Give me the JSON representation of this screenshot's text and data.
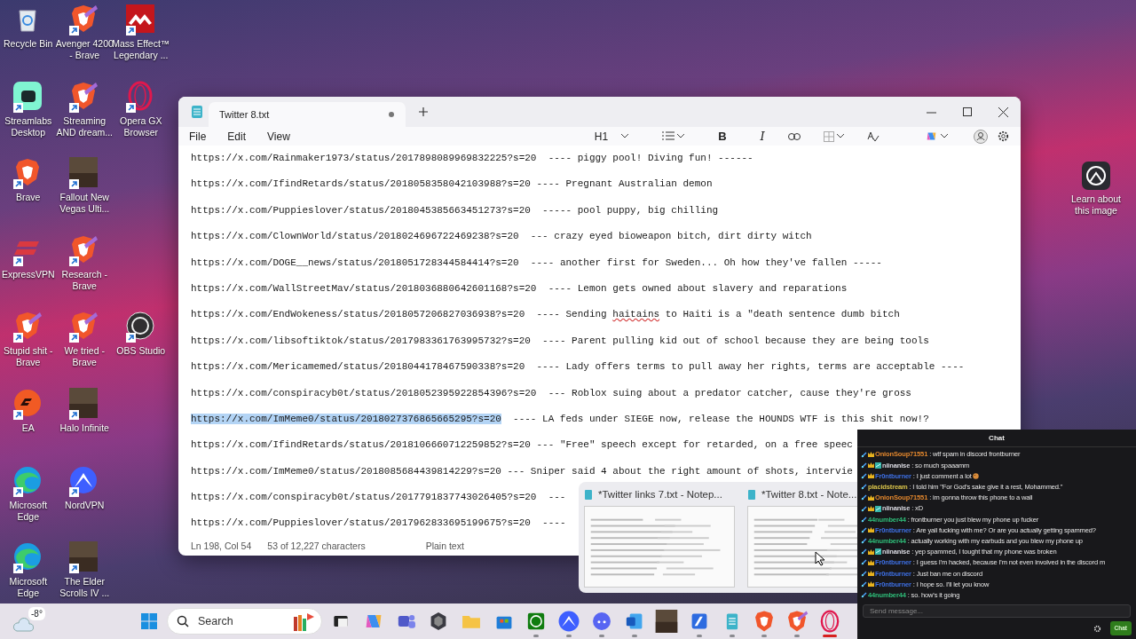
{
  "desktop_rows": [
    [
      {
        "kind": "recycle",
        "label": "Recycle Bin",
        "shortcut": false
      },
      {
        "kind": "brave-profile",
        "label": "Avenger 4200 - Brave",
        "shortcut": true
      },
      {
        "kind": "massfx",
        "label": "Mass Effect™ Legendary ...",
        "shortcut": true
      }
    ],
    [
      {
        "kind": "streamlabs",
        "label": "Streamlabs Desktop",
        "shortcut": true
      },
      {
        "kind": "brave-profile",
        "label": "Streaming AND dream...",
        "shortcut": true
      },
      {
        "kind": "opera",
        "label": "Opera GX Browser",
        "shortcut": true
      }
    ],
    [
      {
        "kind": "brave",
        "label": "Brave",
        "shortcut": true
      },
      {
        "kind": "cover",
        "label": "Fallout New Vegas Ulti...",
        "shortcut": true
      }
    ],
    [
      {
        "kind": "expressvpn",
        "label": "ExpressVPN",
        "shortcut": true
      },
      {
        "kind": "brave-profile",
        "label": "Research - Brave",
        "shortcut": true
      }
    ],
    [
      {
        "kind": "brave-profile",
        "label": "Stupid shit - Brave",
        "shortcut": true
      },
      {
        "kind": "brave-profile",
        "label": "We tried - Brave",
        "shortcut": true
      },
      {
        "kind": "obs",
        "label": "OBS Studio",
        "shortcut": true
      }
    ],
    [
      {
        "kind": "ea",
        "label": "EA",
        "shortcut": true
      },
      {
        "kind": "cover",
        "label": "Halo Infinite",
        "shortcut": true
      }
    ],
    [
      {
        "kind": "edge",
        "label": "Microsoft Edge",
        "shortcut": true
      },
      {
        "kind": "nordvpn",
        "label": "NordVPN",
        "shortcut": true
      }
    ],
    [
      {
        "kind": "edge",
        "label": "Microsoft Edge",
        "shortcut": true
      },
      {
        "kind": "cover",
        "label": "The Elder Scrolls IV ...",
        "shortcut": true
      }
    ]
  ],
  "learn_widget": {
    "label": "Learn about this image"
  },
  "notepad": {
    "tab_title": "Twitter 8.txt",
    "unsaved": true,
    "menu": [
      "File",
      "Edit",
      "View"
    ],
    "toolbar": {
      "heading": "H1",
      "bold": "B",
      "italic": "I"
    },
    "lines": [
      {
        "url": "https://x.com/Rainmaker1973/status/2017898089969832225?s=20",
        "note": [
          {
            "text": "  ---- piggy pool! Diving fun! ------"
          }
        ],
        "selected": false
      },
      {
        "url": "https://x.com/IfindRetards/status/2018058358042103988?s=20",
        "note": [
          {
            "text": " ---- Pregnant Australian demon"
          }
        ],
        "selected": false
      },
      {
        "url": "https://x.com/Puppieslover/status/2018045385663451273?s=20",
        "note": [
          {
            "text": "  ----- pool puppy, big chilling"
          }
        ],
        "selected": false
      },
      {
        "url": "https://x.com/ClownWorld/status/2018024696722469238?s=20",
        "note": [
          {
            "text": "  --- crazy eyed bioweapon bitch, dirt dirty witch"
          }
        ],
        "selected": false
      },
      {
        "url": "https://x.com/DOGE__news/status/2018051728344584414?s=20",
        "note": [
          {
            "text": "  ---- another first for Sweden... Oh how they've fallen -----"
          }
        ],
        "selected": false
      },
      {
        "url": "https://x.com/WallStreetMav/status/2018036880642601168?s=20",
        "note": [
          {
            "text": "  ---- Lemon gets owned about slavery and reparations"
          }
        ],
        "selected": false
      },
      {
        "url": "https://x.com/EndWokeness/status/2018057206827036938?s=20",
        "note": [
          {
            "text": "  ---- Sending "
          },
          {
            "text": "haitains",
            "misspelled": true
          },
          {
            "text": " to Haiti is a \"death sentence dumb bitch"
          }
        ],
        "selected": false
      },
      {
        "url": "https://x.com/libsoftiktok/status/2017983361763995732?s=20",
        "note": [
          {
            "text": "  ---- Parent pulling kid out of school because they are being tools"
          }
        ],
        "selected": false
      },
      {
        "url": "https://x.com/Mericamemed/status/2018044178467590338?s=20",
        "note": [
          {
            "text": "  ---- Lady offers terms to pull away her rights, terms are acceptable ----"
          }
        ],
        "selected": false
      },
      {
        "url": "https://x.com/conspiracyb0t/status/2018052395922854396?s=20",
        "note": [
          {
            "text": "  --- Roblox suing about a predator catcher, cause they're gross"
          }
        ],
        "selected": false
      },
      {
        "url": "https://x.com/ImMeme0/status/2018027376865665295?s=20",
        "note": [
          {
            "text": "  ---- LA feds under SIEGE now, release the HOUNDS WTF is this shit now!?"
          }
        ],
        "selected": true
      },
      {
        "url": "https://x.com/IfindRetards/status/2018106660712259852?s=20",
        "note": [
          {
            "text": " --- \"Free\" speech except for retarded, on a free speec"
          }
        ],
        "selected": false
      },
      {
        "url": "https://x.com/ImMeme0/status/2018085684439814229?s=20",
        "note": [
          {
            "text": " --- Sniper said 4 about the right amount of shots, intervie"
          }
        ],
        "selected": false
      },
      {
        "url": "https://x.com/conspiracyb0t/status/2017791837743026405?s=20",
        "note": [
          {
            "text": "  ---"
          }
        ],
        "selected": false
      },
      {
        "url": "https://x.com/Puppieslover/status/2017962833695199675?s=20",
        "note": [
          {
            "text": "  ----"
          }
        ],
        "selected": false
      }
    ],
    "status": {
      "position": "Ln 198, Col 54",
      "count": "53 of 12,227 characters",
      "format": "Plain text"
    }
  },
  "previews": [
    {
      "title": "*Twitter links 7.txt - Notep..."
    },
    {
      "title": "*Twitter 8.txt - Note..."
    }
  ],
  "chat": {
    "title": "Chat",
    "messages": [
      {
        "user": "OnionSoup71551",
        "color": "#e3872d",
        "sword": true,
        "crown": true,
        "emote": false,
        "cookie": false,
        "text": ": wtf spam in discord frontburner"
      },
      {
        "user": "niinanise",
        "color": "#dcdce4",
        "sword": true,
        "crown": true,
        "emote": true,
        "cookie": false,
        "text": ": so much spaaamm"
      },
      {
        "user": "Fr0ntburner",
        "color": "#3d6fe3",
        "sword": true,
        "crown": true,
        "emote": false,
        "cookie": true,
        "text": ": I just comment a lot"
      },
      {
        "user": "placidstream",
        "color": "#d8c24a",
        "sword": true,
        "crown": false,
        "emote": false,
        "cookie": false,
        "text": ": I told him \"For God's sake give it a rest, Mohammed.\""
      },
      {
        "user": "OnionSoup71551",
        "color": "#e3872d",
        "sword": true,
        "crown": true,
        "emote": false,
        "cookie": false,
        "text": ": im gonna throw this phone to a wall"
      },
      {
        "user": "niinanise",
        "color": "#dcdce4",
        "sword": true,
        "crown": true,
        "emote": true,
        "cookie": false,
        "text": ": xD"
      },
      {
        "user": "44number44",
        "color": "#2fbf7a",
        "sword": true,
        "crown": false,
        "emote": false,
        "cookie": false,
        "text": ": frontburner you just blew my phone up fucker"
      },
      {
        "user": "Fr0ntburner",
        "color": "#3d6fe3",
        "sword": true,
        "crown": true,
        "emote": false,
        "cookie": false,
        "text": ": Are yall fucking with me? Or are you actually getting spammed?"
      },
      {
        "user": "44number44",
        "color": "#2fbf7a",
        "sword": true,
        "crown": false,
        "emote": false,
        "cookie": false,
        "text": ": actually working with my earbuds and you blew my phone up"
      },
      {
        "user": "niinanise",
        "color": "#dcdce4",
        "sword": true,
        "crown": true,
        "emote": true,
        "cookie": false,
        "text": ": yep spammed, I tought that my phone was broken"
      },
      {
        "user": "Fr0ntburner",
        "color": "#3d6fe3",
        "sword": true,
        "crown": true,
        "emote": false,
        "cookie": false,
        "text": ": I guess I'm hacked, because I'm not even involved in the discord m"
      },
      {
        "user": "Fr0ntburner",
        "color": "#3d6fe3",
        "sword": true,
        "crown": true,
        "emote": false,
        "cookie": false,
        "text": ": Just ban me on discord"
      },
      {
        "user": "Fr0ntburner",
        "color": "#3d6fe3",
        "sword": true,
        "crown": true,
        "emote": false,
        "cookie": false,
        "text": ": I hope so. I'll let you know"
      },
      {
        "user": "44number44",
        "color": "#2fbf7a",
        "sword": true,
        "crown": false,
        "emote": false,
        "cookie": false,
        "text": ": so. how's it going"
      }
    ],
    "input": {
      "placeholder": "Send message..."
    },
    "send_label": "Chat"
  },
  "taskbar": {
    "weather": "-8°",
    "search": {
      "placeholder": "Search"
    },
    "apps": [
      {
        "kind": "taskview",
        "running": false,
        "selected": false
      },
      {
        "kind": "copilot",
        "running": false,
        "selected": false
      },
      {
        "kind": "teams",
        "running": false,
        "selected": false
      },
      {
        "kind": "hexagon",
        "running": false,
        "selected": false
      },
      {
        "kind": "folder",
        "running": false,
        "selected": false
      },
      {
        "kind": "store",
        "running": false,
        "selected": false
      },
      {
        "kind": "xbox",
        "running": true,
        "selected": false
      },
      {
        "kind": "nordvpn",
        "running": true,
        "selected": false
      },
      {
        "kind": "discord",
        "running": true,
        "selected": false
      },
      {
        "kind": "word",
        "running": true,
        "selected": false
      },
      {
        "kind": "cover",
        "running": false,
        "selected": false
      },
      {
        "kind": "blueapp",
        "running": true,
        "selected": false
      },
      {
        "kind": "notepad",
        "running": true,
        "selected": false
      },
      {
        "kind": "brave",
        "running": true,
        "selected": false
      },
      {
        "kind": "brave-profile",
        "running": true,
        "selected": false
      },
      {
        "kind": "opera",
        "running": true,
        "selected": true
      }
    ]
  }
}
